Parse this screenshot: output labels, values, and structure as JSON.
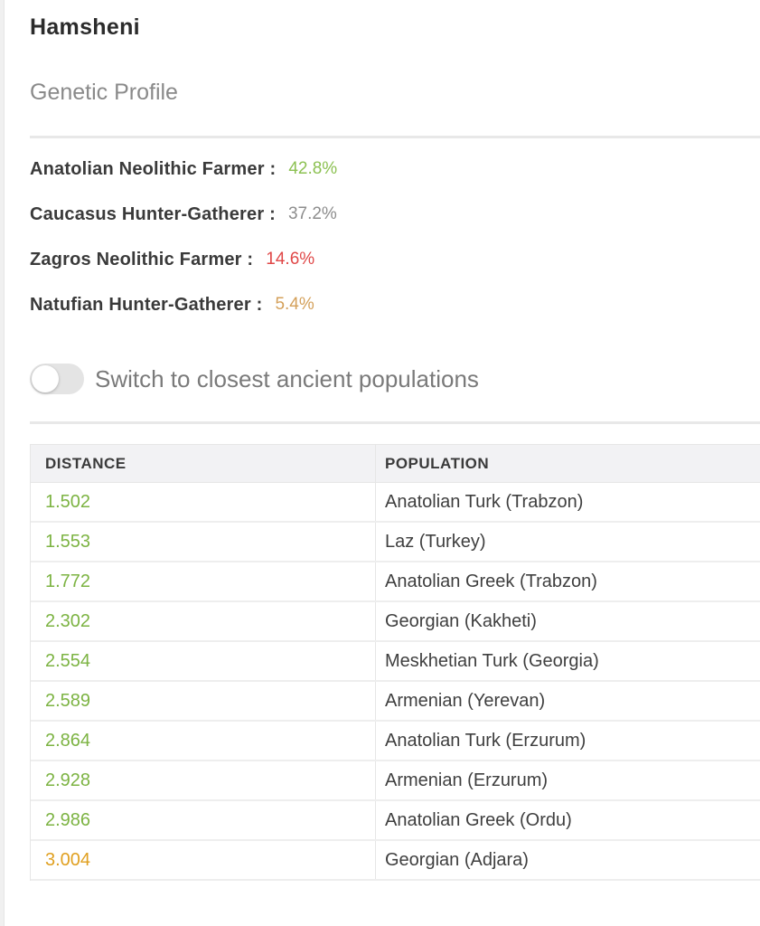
{
  "header": {
    "title": "Hamsheni",
    "subtitle": "Genetic Profile"
  },
  "profile": [
    {
      "label": "Anatolian Neolithic Farmer :",
      "value": "42.8%",
      "color": "#8cc152"
    },
    {
      "label": "Caucasus Hunter-Gatherer :",
      "value": "37.2%",
      "color": "#8d8d8d"
    },
    {
      "label": "Zagros Neolithic Farmer :",
      "value": "14.6%",
      "color": "#e04848"
    },
    {
      "label": "Natufian Hunter-Gatherer :",
      "value": "5.4%",
      "color": "#d4a05a"
    }
  ],
  "toggle": {
    "label": "Switch to closest ancient populations",
    "state": "off"
  },
  "table": {
    "headers": {
      "distance": "DISTANCE",
      "population": "POPULATION"
    },
    "rows": [
      {
        "distance": "1.502",
        "population": "Anatolian Turk (Trabzon)",
        "color": "#7cb342"
      },
      {
        "distance": "1.553",
        "population": "Laz (Turkey)",
        "color": "#7cb342"
      },
      {
        "distance": "1.772",
        "population": "Anatolian Greek (Trabzon)",
        "color": "#7cb342"
      },
      {
        "distance": "2.302",
        "population": "Georgian (Kakheti)",
        "color": "#7cb342"
      },
      {
        "distance": "2.554",
        "population": "Meskhetian Turk (Georgia)",
        "color": "#7cb342"
      },
      {
        "distance": "2.589",
        "population": "Armenian (Yerevan)",
        "color": "#7cb342"
      },
      {
        "distance": "2.864",
        "population": "Anatolian Turk (Erzurum)",
        "color": "#7cb342"
      },
      {
        "distance": "2.928",
        "population": "Armenian (Erzurum)",
        "color": "#7cb342"
      },
      {
        "distance": "2.986",
        "population": "Anatolian Greek (Ordu)",
        "color": "#7cb342"
      },
      {
        "distance": "3.004",
        "population": "Georgian (Adjara)",
        "color": "#e0a020"
      }
    ]
  }
}
